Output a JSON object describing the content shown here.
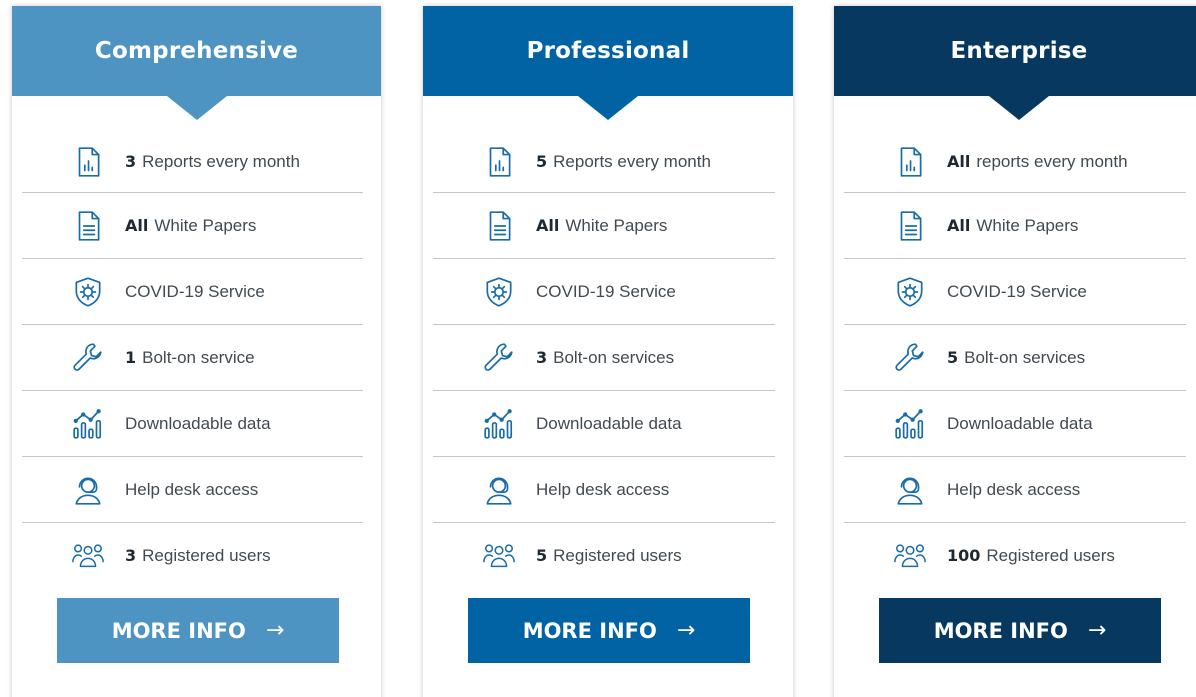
{
  "plans": [
    {
      "title": "Comprehensive",
      "color": "#4d94c2",
      "features": [
        {
          "icon": "report-icon",
          "bold": "3",
          "text": "Reports every month"
        },
        {
          "icon": "document-icon",
          "bold": "All",
          "text": "White Papers"
        },
        {
          "icon": "virus-shield-icon",
          "bold": "",
          "text": "COVID-19 Service"
        },
        {
          "icon": "wrench-icon",
          "bold": "1",
          "text": "Bolt-on service"
        },
        {
          "icon": "chart-icon",
          "bold": "",
          "text": "Downloadable data"
        },
        {
          "icon": "headset-icon",
          "bold": "",
          "text": "Help desk access"
        },
        {
          "icon": "users-icon",
          "bold": "3",
          "text": "Registered users"
        }
      ],
      "button_label": "MORE INFO",
      "button_arrow": "→"
    },
    {
      "title": "Professional",
      "color": "#0163a3",
      "features": [
        {
          "icon": "report-icon",
          "bold": "5",
          "text": "Reports every month"
        },
        {
          "icon": "document-icon",
          "bold": "All",
          "text": "White Papers"
        },
        {
          "icon": "virus-shield-icon",
          "bold": "",
          "text": "COVID-19 Service"
        },
        {
          "icon": "wrench-icon",
          "bold": "3",
          "text": "Bolt-on services"
        },
        {
          "icon": "chart-icon",
          "bold": "",
          "text": "Downloadable data"
        },
        {
          "icon": "headset-icon",
          "bold": "",
          "text": "Help desk access"
        },
        {
          "icon": "users-icon",
          "bold": "5",
          "text": "Registered users"
        }
      ],
      "button_label": "MORE INFO",
      "button_arrow": "→"
    },
    {
      "title": "Enterprise",
      "color": "#063860",
      "features": [
        {
          "icon": "report-icon",
          "bold": "All",
          "text": "reports every month"
        },
        {
          "icon": "document-icon",
          "bold": "All",
          "text": "White Papers"
        },
        {
          "icon": "virus-shield-icon",
          "bold": "",
          "text": "COVID-19 Service"
        },
        {
          "icon": "wrench-icon",
          "bold": "5",
          "text": "Bolt-on services"
        },
        {
          "icon": "chart-icon",
          "bold": "",
          "text": "Downloadable data"
        },
        {
          "icon": "headset-icon",
          "bold": "",
          "text": "Help desk access"
        },
        {
          "icon": "users-icon",
          "bold": "100",
          "text": "Registered users"
        }
      ],
      "button_label": "MORE INFO",
      "button_arrow": "→"
    }
  ],
  "icon_color": "#1a6ca8"
}
